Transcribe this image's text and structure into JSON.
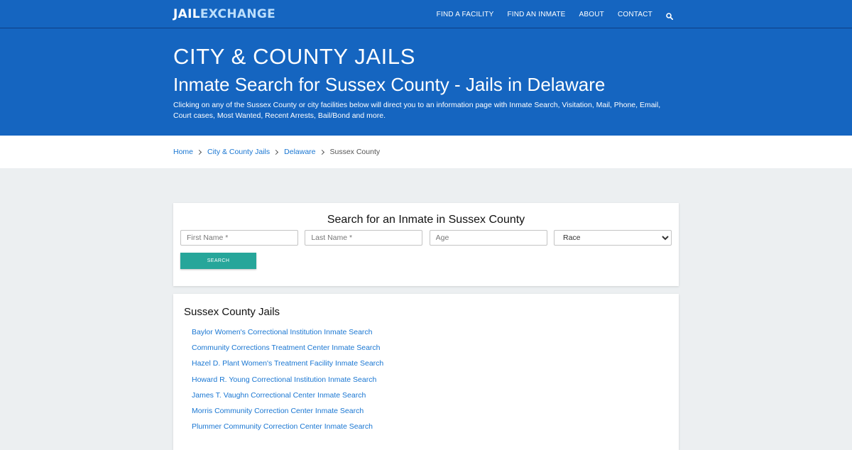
{
  "nav": {
    "logo_part1": "JAIL",
    "logo_part2": "EXCHANGE",
    "links": [
      "FIND A FACILITY",
      "FIND AN INMATE",
      "ABOUT",
      "CONTACT"
    ],
    "search_icon": "search-icon"
  },
  "hero": {
    "title": "CITY & COUNTY JAILS",
    "subtitle": "Inmate Search for Sussex County - Jails in Delaware",
    "description": "Clicking on any of the Sussex County or city facilities below will direct you to an information page with Inmate Search, Visitation, Mail, Phone, Email, Court cases, Most Wanted, Recent Arrests, Bail/Bond and more."
  },
  "breadcrumb": {
    "items": [
      "Home",
      "City & County Jails",
      "Delaware"
    ],
    "current": "Sussex County"
  },
  "search_form": {
    "title": "Search for an Inmate in Sussex County",
    "first_name_placeholder": "First Name *",
    "last_name_placeholder": "Last Name *",
    "age_placeholder": "Age",
    "race_selected": "Race",
    "button_label": "SEARCH"
  },
  "jails": {
    "title": "Sussex County Jails",
    "items": [
      "Baylor Women's Correctional Institution Inmate Search",
      "Community Corrections Treatment Center Inmate Search",
      "Hazel D. Plant Women's Treatment Facility Inmate Search",
      "Howard R. Young Correctional Institution Inmate Search",
      "James T. Vaughn Correctional Center Inmate Search",
      "Morris Community Correction Center Inmate Search",
      "Plummer Community Correction Center Inmate Search"
    ]
  },
  "colors": {
    "primary": "#1565c0",
    "link": "#1976d2",
    "button": "#26a69a",
    "background": "#eceff1"
  }
}
